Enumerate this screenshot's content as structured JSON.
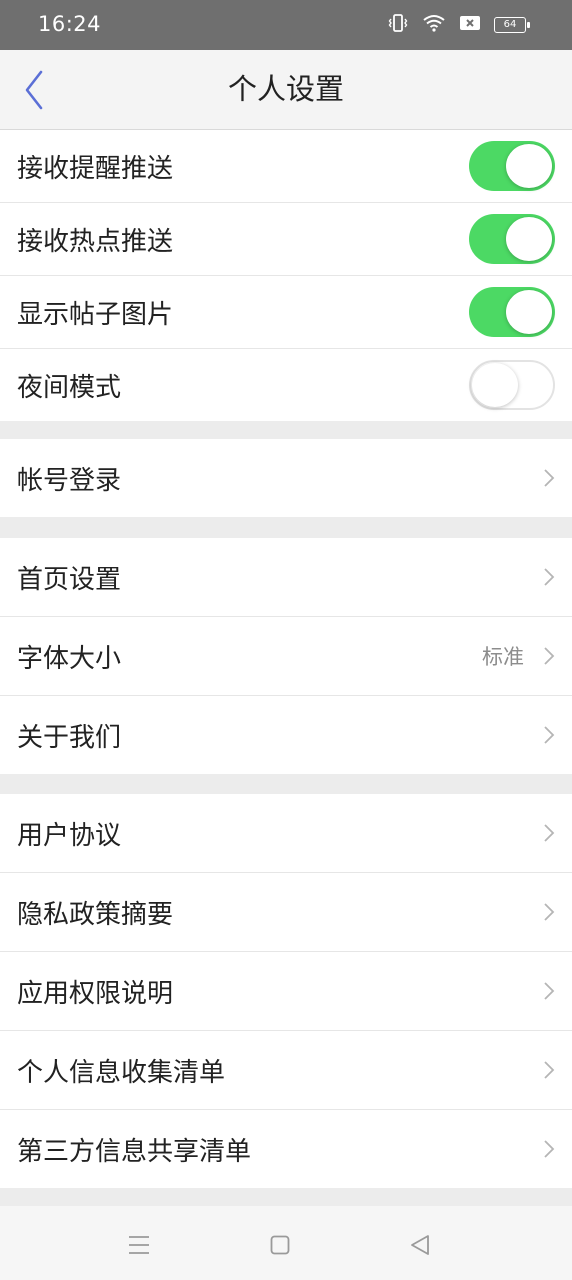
{
  "status_bar": {
    "time": "16:24",
    "battery": "64",
    "icons": [
      "vibrate-icon",
      "wifi-icon",
      "sim-disabled-icon",
      "battery-icon"
    ]
  },
  "header": {
    "title": "个人设置",
    "back_icon": "chevron-left-icon"
  },
  "toggles": [
    {
      "label": "接收提醒推送",
      "on": true
    },
    {
      "label": "接收热点推送",
      "on": true
    },
    {
      "label": "显示帖子图片",
      "on": true
    },
    {
      "label": "夜间模式",
      "on": false
    }
  ],
  "account": {
    "login_label": "帐号登录"
  },
  "general": {
    "home_settings": "首页设置",
    "font_size": "字体大小",
    "font_size_value": "标准",
    "about_us": "关于我们"
  },
  "legal": {
    "user_agreement": "用户协议",
    "privacy_summary": "隐私政策摘要",
    "permissions": "应用权限说明",
    "personal_info": "个人信息收集清单",
    "third_party": "第三方信息共享清单"
  },
  "colors": {
    "toggle_on": "#4cd964",
    "back_arrow": "#5b6fd6",
    "status_bar": "#6f6f6f"
  },
  "bottom_nav": [
    "menu-icon",
    "home-icon",
    "back-icon"
  ]
}
